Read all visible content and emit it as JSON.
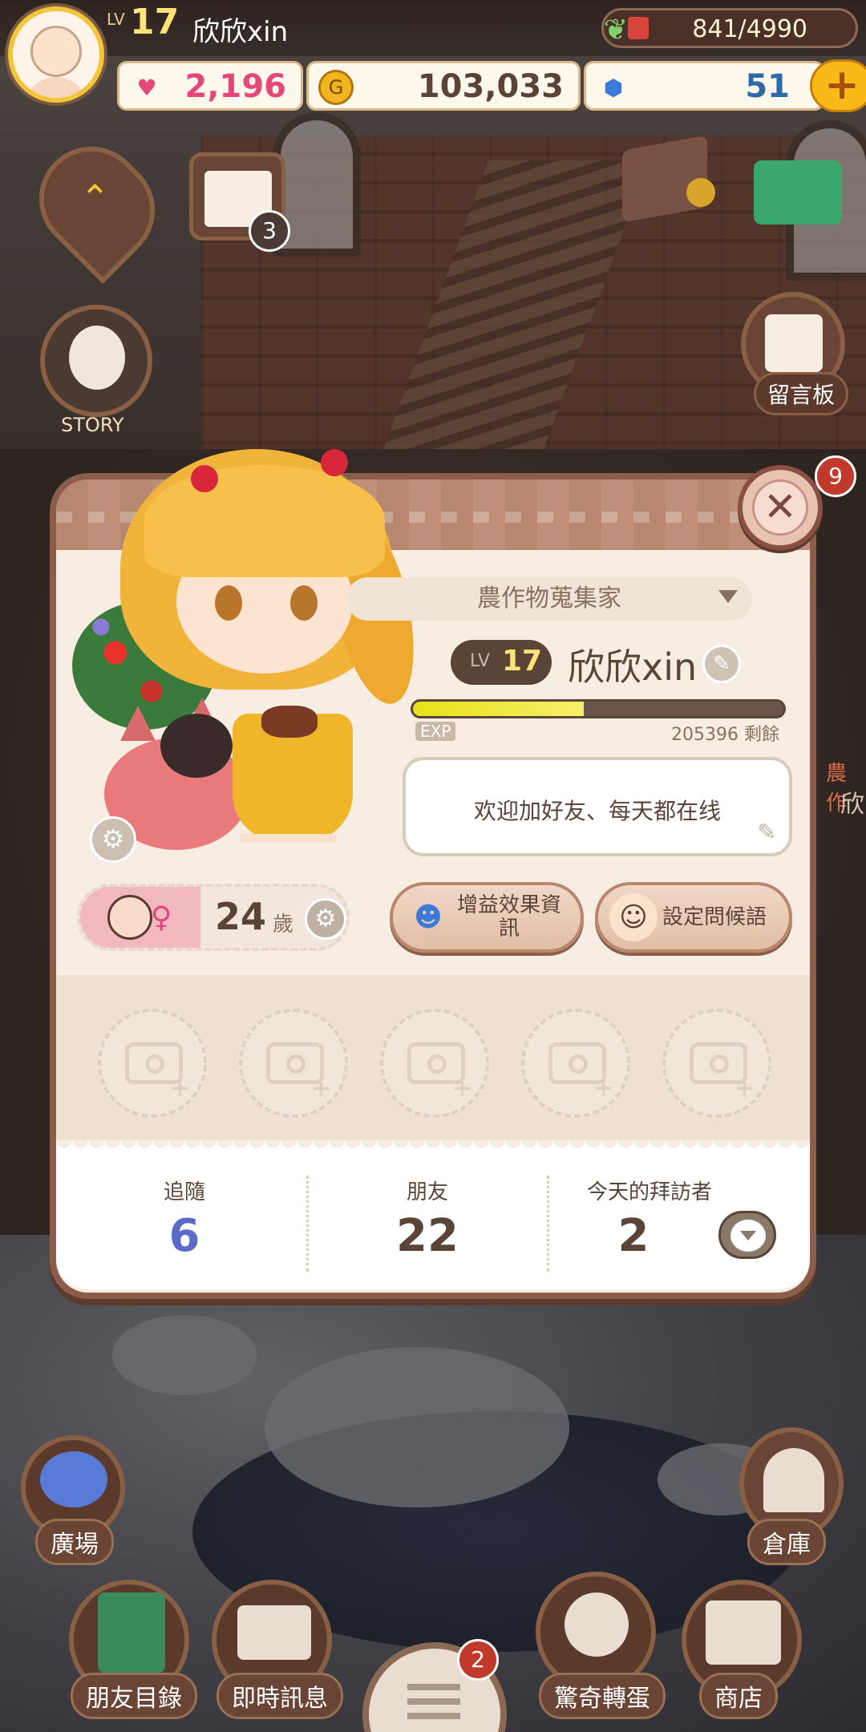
{
  "hud": {
    "level_label": "LV",
    "level": "17",
    "player_name": "欣欣xin",
    "energy": "841/4990",
    "hearts": "2,196",
    "coins": "103,033",
    "gems": "51",
    "plus": "+",
    "energy_fraction": 0.17
  },
  "scene": {
    "story_label": "STORY",
    "calendar_badge": "3",
    "message_board_label": "留言板",
    "right_badge": "9",
    "plaza_label": "廣場",
    "warehouse_label": "倉庫",
    "partial_right_text": "農作",
    "partial_right_text2": "欣"
  },
  "profile": {
    "title": "農作物蒐集家",
    "level_label": "LV",
    "level": "17",
    "name": "欣欣xin",
    "exp_label": "EXP",
    "exp_remaining": "205396 剩餘",
    "exp_fraction": 0.46,
    "greeting": "欢迎加好友、每天都在线",
    "age": "24",
    "age_unit": "歲",
    "buff_button": "增益效果資\n訊",
    "greeting_button": "設定問候語",
    "close": "✕"
  },
  "stats": {
    "follow_label": "追隨",
    "follow_value": "6",
    "friends_label": "朋友",
    "friends_value": "22",
    "visitors_label": "今天的拜訪者",
    "visitors_value": "2"
  },
  "nav": {
    "friends_list": "朋友目錄",
    "instant_messages": "即時訊息",
    "menu_badge": "2",
    "surprise_egg": "驚奇轉蛋",
    "shop": "商店"
  },
  "colors": {
    "follow_value": "#5a6ac8",
    "hearts": "#e4477a",
    "gems": "#2f6aa8",
    "accent": "#f9b919"
  }
}
